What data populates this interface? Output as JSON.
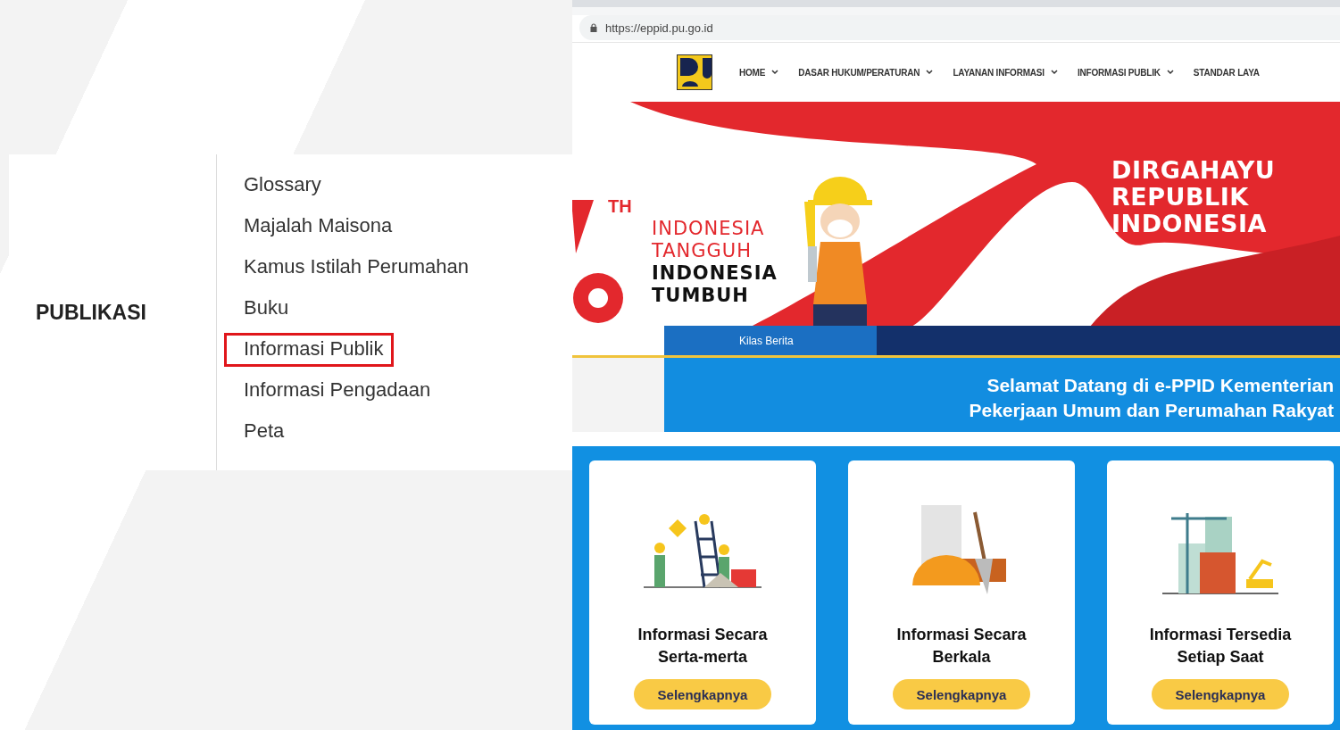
{
  "publikasi_menu": {
    "heading": "PUBLIKASI",
    "items": [
      {
        "label": "Glossary",
        "highlighted": false
      },
      {
        "label": "Majalah Maisona",
        "highlighted": false
      },
      {
        "label": "Kamus Istilah Perumahan",
        "highlighted": false
      },
      {
        "label": "Buku",
        "highlighted": false
      },
      {
        "label": "Informasi Publik",
        "highlighted": true
      },
      {
        "label": "Informasi Pengadaan",
        "highlighted": false
      },
      {
        "label": "Peta",
        "highlighted": false
      }
    ]
  },
  "browser": {
    "url": "https://eppid.pu.go.id"
  },
  "site_nav": [
    {
      "label": "HOME",
      "dropdown": true
    },
    {
      "label": "DASAR HUKUM/PERATURAN",
      "dropdown": true
    },
    {
      "label": "LAYANAN INFORMASI",
      "dropdown": true
    },
    {
      "label": "INFORMASI PUBLIK",
      "dropdown": true
    },
    {
      "label": "STANDAR LAYA",
      "dropdown": false
    }
  ],
  "banner": {
    "badge": "TH",
    "slogan": [
      {
        "text": "INDONESIA",
        "kind": "light"
      },
      {
        "text": "TANGGUH",
        "kind": "light"
      },
      {
        "text": "INDONESIA",
        "kind": "dark"
      },
      {
        "text": "TUMBUH",
        "kind": "dark"
      }
    ],
    "title_lines": [
      "DIRGAHAYU",
      "REPUBLIK",
      "INDONESIA"
    ]
  },
  "ticker": {
    "label": "Kilas Berita"
  },
  "welcome_lines": [
    "Selamat Datang di e-PPID Kementerian",
    "Pekerjaan Umum dan Perumahan Rakyat"
  ],
  "cards": [
    {
      "kind": "workers",
      "title": "Informasi Secara Serta-merta",
      "button": "Selengkapnya"
    },
    {
      "kind": "tools",
      "title": "Informasi Secara Berkala",
      "button": "Selengkapnya"
    },
    {
      "kind": "building",
      "title": "Informasi Tersedia Setiap Saat",
      "button": "Selengkapnya"
    }
  ]
}
